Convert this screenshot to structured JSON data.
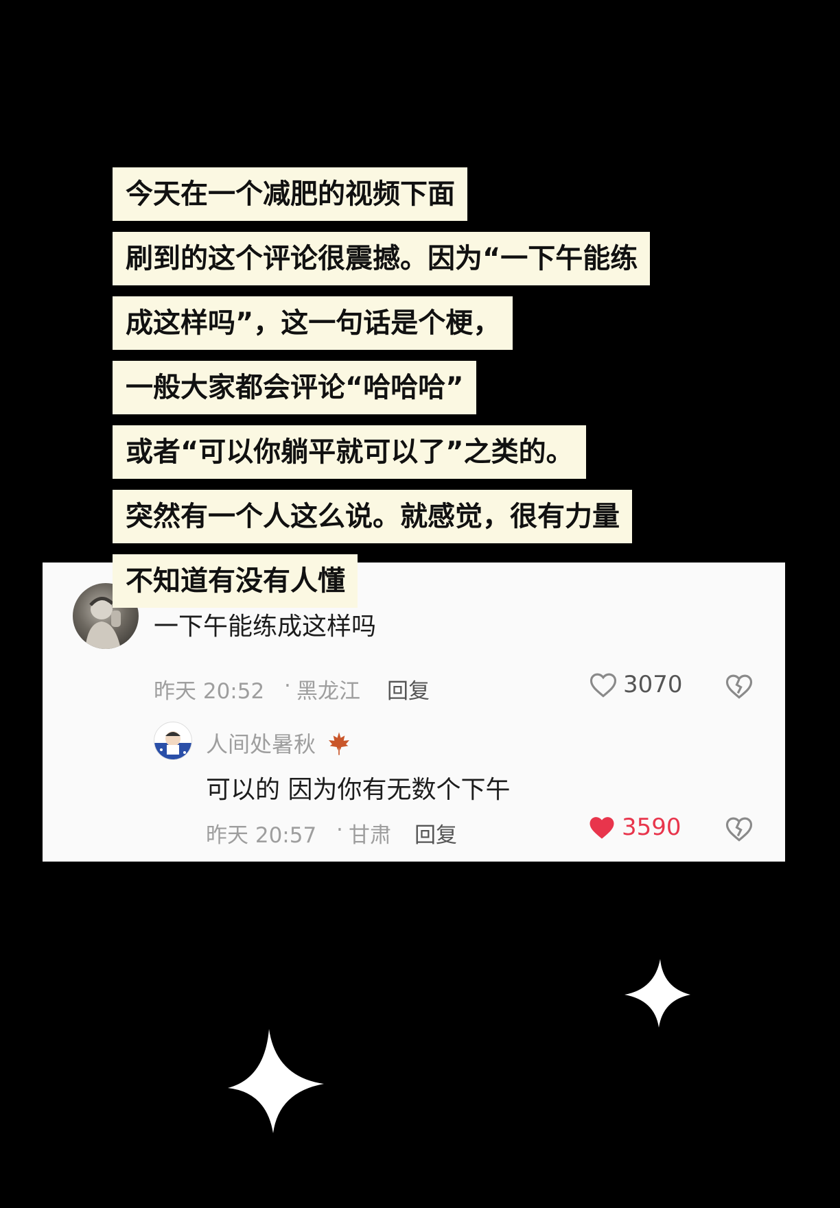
{
  "caption": {
    "lines": [
      "今天在一个减肥的视频下面",
      "刷到的这个评论很震撼。因为“一下午能练",
      "成这样吗”，这一句话是个梗，",
      "一般大家都会评论“哈哈哈”",
      "或者“可以你躺平就可以了”之类的。",
      "突然有一个人这么说。就感觉，很有力量",
      "不知道有没有人懂"
    ]
  },
  "comment": {
    "text": "一下午能练成这样吗",
    "time": "昨天 20:52",
    "location": "黑龙江",
    "reply_label": "回复",
    "likes": "3070",
    "liked": false
  },
  "reply": {
    "username": "人间处暑秋",
    "text": "可以的 因为你有无数个下午",
    "time": "昨天 20:57",
    "location": "甘肃",
    "reply_label": "回复",
    "likes": "3590",
    "liked": true
  },
  "colors": {
    "caption_bg": "#fbf8e2",
    "liked_red": "#e8354c",
    "page_bg": "#000000"
  }
}
